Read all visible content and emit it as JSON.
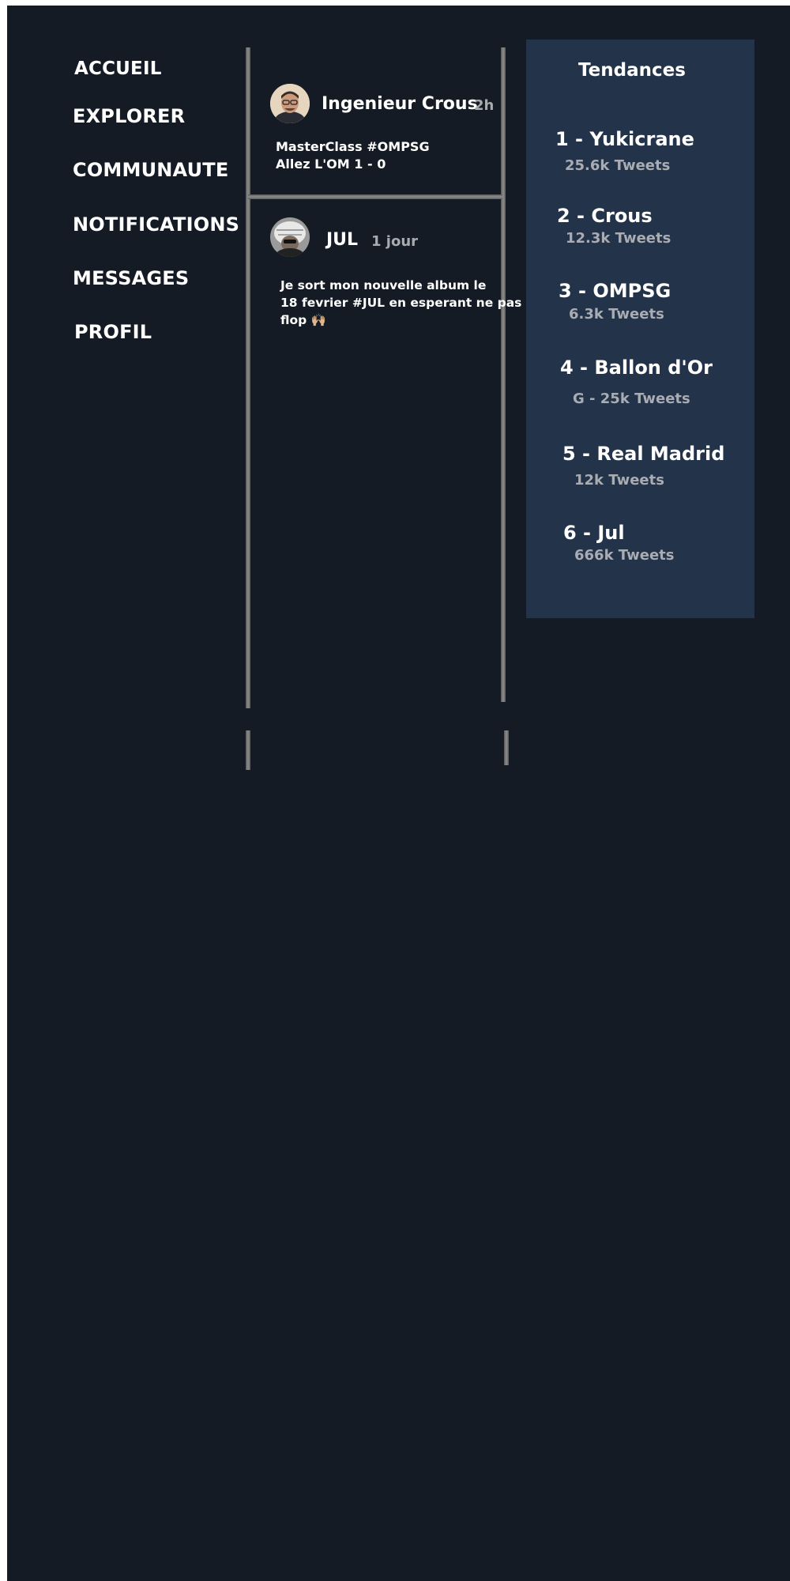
{
  "nav": {
    "items": [
      {
        "label": "ACCUEIL"
      },
      {
        "label": "EXPLORER"
      },
      {
        "label": "COMMUNAUTE"
      },
      {
        "label": "NOTIFICATIONS"
      },
      {
        "label": "MESSAGES"
      },
      {
        "label": "PROFIL"
      }
    ]
  },
  "feed": {
    "tweets": [
      {
        "author": "Ingenieur Crous",
        "time": "2h",
        "lines": [
          "MasterClass #OMPSG",
          "Allez L'OM 1 - 0"
        ]
      },
      {
        "author": "JUL",
        "time": "1 jour",
        "lines": [
          "Je sort mon nouvelle album le",
          "18 fevrier #JUL en esperant ne pas",
          "flop"
        ],
        "emoji": "🙌🏼"
      }
    ]
  },
  "trends": {
    "title": "Tendances",
    "items": [
      {
        "name": "1 - Yukicrane",
        "count": "25.6k Tweets"
      },
      {
        "name": "2 - Crous",
        "count": "12.3k Tweets"
      },
      {
        "name": "3 - OMPSG",
        "count": "6.3k Tweets"
      },
      {
        "name": "4 - Ballon d'Or",
        "count": "G - 25k Tweets"
      },
      {
        "name": "5 - Real Madrid",
        "count": "12k Tweets"
      },
      {
        "name": "6 - Jul",
        "count": "666k Tweets"
      }
    ]
  },
  "colors": {
    "background": "#151b24",
    "trends_panel": "#23334a",
    "text": "#ffffff",
    "muted_text": "#a9acb2"
  }
}
